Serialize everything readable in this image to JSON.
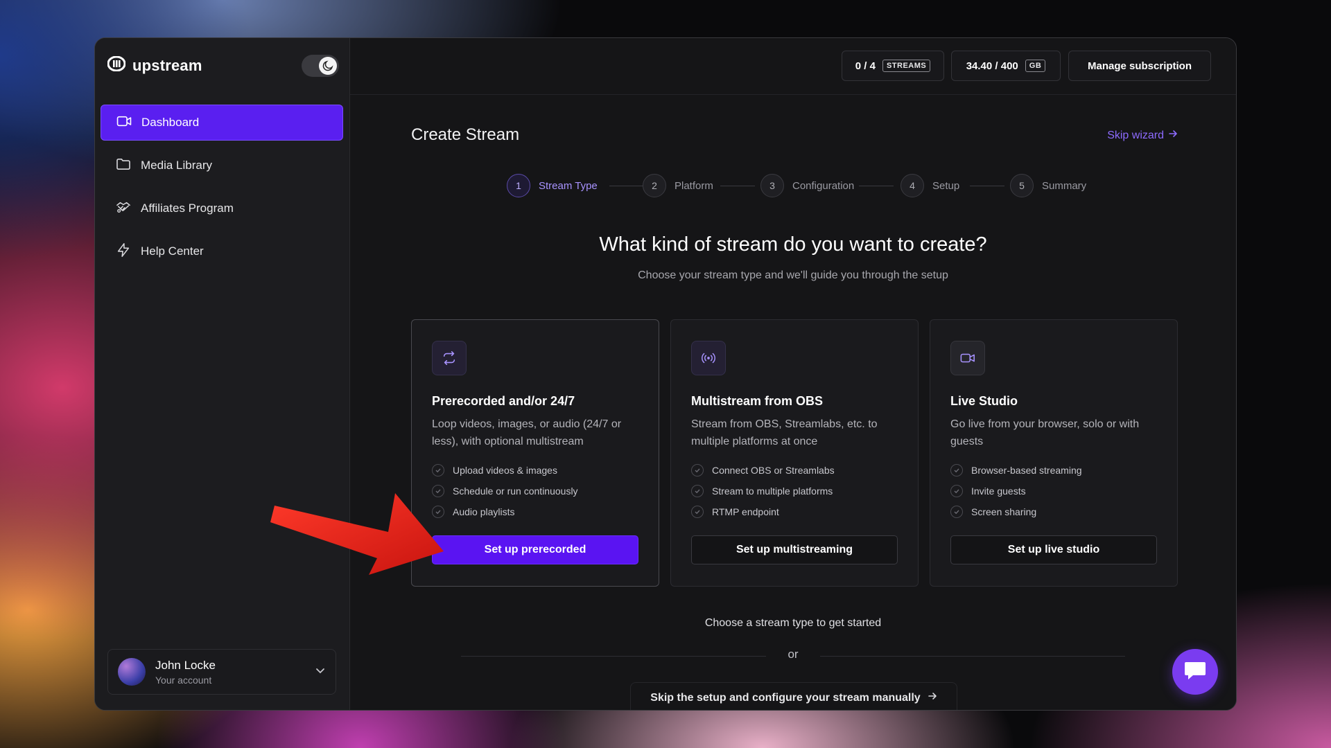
{
  "brand": {
    "name": "upstream"
  },
  "sidebar": {
    "items": [
      {
        "label": "Dashboard",
        "icon": "video-camera-icon",
        "active": true
      },
      {
        "label": "Media Library",
        "icon": "folder-icon"
      },
      {
        "label": "Affiliates Program",
        "icon": "handshake-icon"
      },
      {
        "label": "Help Center",
        "icon": "lightning-icon"
      }
    ]
  },
  "account": {
    "name": "John Locke",
    "subtitle": "Your account"
  },
  "topbar": {
    "streams_count": "0 / 4",
    "streams_tag": "STREAMS",
    "storage_count": "34.40 / 400",
    "storage_tag": "GB",
    "manage_label": "Manage subscription"
  },
  "page": {
    "title": "Create Stream",
    "skip_wizard": "Skip wizard",
    "headline": "What kind of stream do you want to create?",
    "subheadline": "Choose your stream type and we'll guide you through the setup",
    "choose_prompt": "Choose a stream type to get started",
    "or_text": "or",
    "skip_manual": "Skip the setup and configure your stream manually"
  },
  "steps": [
    {
      "num": "1",
      "label": "Stream Type",
      "active": true
    },
    {
      "num": "2",
      "label": "Platform"
    },
    {
      "num": "3",
      "label": "Configuration"
    },
    {
      "num": "4",
      "label": "Setup"
    },
    {
      "num": "5",
      "label": "Summary"
    }
  ],
  "cards": [
    {
      "icon": "repeat-icon",
      "title": "Prerecorded and/or 24/7",
      "description": "Loop videos, images, or audio (24/7 or less), with optional multistream",
      "features": [
        "Upload videos & images",
        "Schedule or run continuously",
        "Audio playlists"
      ],
      "button": "Set up prerecorded"
    },
    {
      "icon": "broadcast-icon",
      "title": "Multistream from OBS",
      "description": "Stream from OBS, Streamlabs, etc. to multiple platforms at once",
      "features": [
        "Connect OBS or Streamlabs",
        "Stream to multiple platforms",
        "RTMP endpoint"
      ],
      "button": "Set up multistreaming"
    },
    {
      "icon": "video-camera-icon",
      "title": "Live Studio",
      "description": "Go live from your browser, solo or with guests",
      "features": [
        "Browser-based streaming",
        "Invite guests",
        "Screen sharing"
      ],
      "button": "Set up live studio"
    }
  ],
  "colors": {
    "accent": "#5a14f2",
    "accent_text": "#8d6bff",
    "annotation_arrow": "#e8231f"
  }
}
